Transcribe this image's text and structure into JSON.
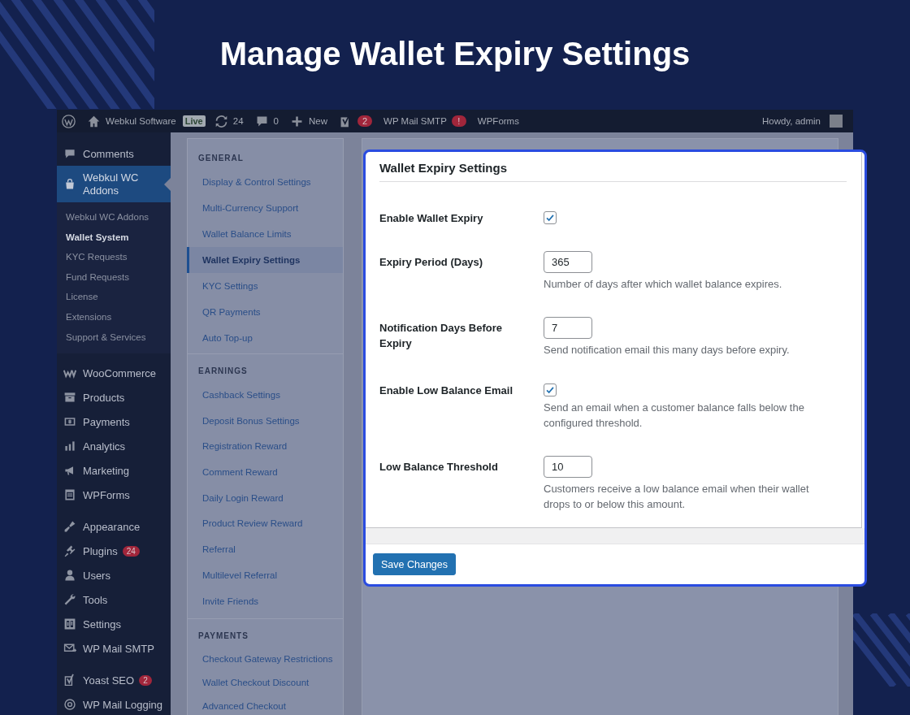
{
  "page_title": "Manage Wallet Expiry Settings",
  "admin_bar": {
    "site_name": "Webkul Software",
    "environment_badge": "Live",
    "updates_count": "24",
    "comments_count": "0",
    "new_label": "New",
    "seo_badge": "2",
    "smtp_label": "WP Mail SMTP",
    "smtp_badge": "!",
    "forms_label": "WPForms",
    "greeting": "Howdy, admin"
  },
  "sidebar": {
    "groups": [
      {
        "items": [
          {
            "label": "Comments",
            "selected": false
          },
          {
            "label": "Webkul WC Addons",
            "selected": true,
            "submenu": [
              {
                "label": "Webkul WC Addons",
                "selected": false
              },
              {
                "label": "Wallet System",
                "selected": true
              },
              {
                "label": "KYC Requests",
                "selected": false
              },
              {
                "label": "Fund Requests",
                "selected": false
              },
              {
                "label": "License",
                "selected": false
              },
              {
                "label": "Extensions",
                "selected": false
              },
              {
                "label": "Support & Services",
                "selected": false
              }
            ]
          }
        ]
      },
      {
        "items": [
          {
            "label": "WooCommerce",
            "selected": false
          },
          {
            "label": "Products",
            "selected": false
          },
          {
            "label": "Payments",
            "selected": false
          },
          {
            "label": "Analytics",
            "selected": false
          },
          {
            "label": "Marketing",
            "selected": false
          },
          {
            "label": "WPForms",
            "selected": false
          }
        ]
      },
      {
        "items": [
          {
            "label": "Appearance",
            "selected": false
          },
          {
            "label": "Plugins",
            "selected": false,
            "badge": "24"
          },
          {
            "label": "Users",
            "selected": false
          },
          {
            "label": "Tools",
            "selected": false
          },
          {
            "label": "Settings",
            "selected": false
          },
          {
            "label": "WP Mail SMTP",
            "selected": false
          }
        ]
      },
      {
        "items": [
          {
            "label": "Yoast SEO",
            "selected": false,
            "badge": "2"
          },
          {
            "label": "WP Mail Logging",
            "selected": false
          }
        ]
      }
    ]
  },
  "settings_nav": {
    "sections": [
      {
        "heading": "GENERAL",
        "items": [
          {
            "label": "Display & Control Settings",
            "selected": false
          },
          {
            "label": "Multi-Currency Support",
            "selected": false
          },
          {
            "label": "Wallet Balance Limits",
            "selected": false
          },
          {
            "label": "Wallet Expiry Settings",
            "selected": true
          },
          {
            "label": "KYC Settings",
            "selected": false
          },
          {
            "label": "QR Payments",
            "selected": false
          },
          {
            "label": "Auto Top-up",
            "selected": false
          }
        ]
      },
      {
        "heading": "EARNINGS",
        "items": [
          {
            "label": "Cashback Settings",
            "selected": false
          },
          {
            "label": "Deposit Bonus Settings",
            "selected": false
          },
          {
            "label": "Registration Reward",
            "selected": false
          },
          {
            "label": "Comment Reward",
            "selected": false
          },
          {
            "label": "Daily Login Reward",
            "selected": false
          },
          {
            "label": "Product Review Reward",
            "selected": false
          },
          {
            "label": "Referral",
            "selected": false
          },
          {
            "label": "Multilevel Referral",
            "selected": false
          },
          {
            "label": "Invite Friends",
            "selected": false
          }
        ]
      },
      {
        "heading": "PAYMENTS",
        "items": [
          {
            "label": "Checkout Gateway Restrictions",
            "selected": false
          },
          {
            "label": "Wallet Checkout Discount",
            "selected": false
          },
          {
            "label": "Advanced Checkout",
            "selected": false
          }
        ]
      }
    ]
  },
  "dialog": {
    "title": "Wallet Expiry Settings",
    "fields": [
      {
        "kind": "checkbox",
        "label": "Enable Wallet Expiry",
        "checked": true
      },
      {
        "kind": "number",
        "label": "Expiry Period (Days)",
        "value": "365",
        "description": "Number of days after which wallet balance expires."
      },
      {
        "kind": "number",
        "label": "Notification Days Before Expiry",
        "value": "7",
        "description": "Send notification email this many days before expiry."
      },
      {
        "kind": "checkbox",
        "label": "Enable Low Balance Email",
        "checked": true,
        "description": "Send an email when a customer balance falls below the configured threshold."
      },
      {
        "kind": "number",
        "label": "Low Balance Threshold",
        "value": "10",
        "description": "Customers receive a low balance email when their wallet drops to or below this amount."
      }
    ],
    "save_button": "Save Changes"
  }
}
